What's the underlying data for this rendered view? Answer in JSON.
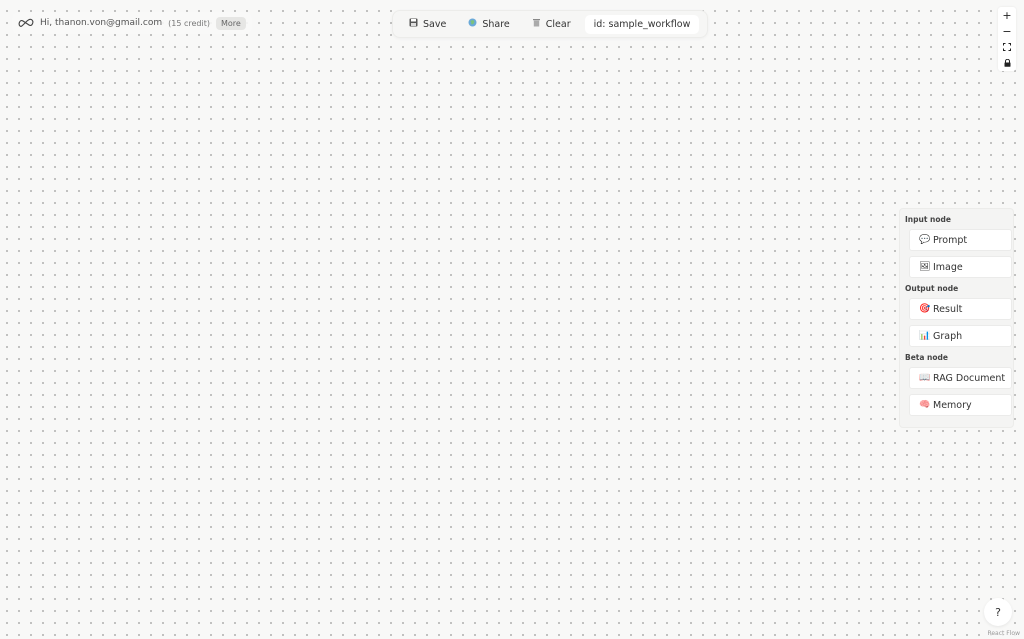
{
  "user_bar": {
    "greeting": "Hi, thanon.von@gmail.com",
    "credit": "(15 credit)",
    "more_label": "More",
    "logo_icon": "infinity-link-icon"
  },
  "toolbar": {
    "save_label": "Save",
    "save_icon": "floppy-disk-icon",
    "share_label": "Share",
    "share_icon": "globe-icon",
    "clear_label": "Clear",
    "clear_icon": "trash-icon",
    "id_label": "id: sample_workflow"
  },
  "controls": {
    "zoom_in": "+",
    "zoom_out": "−",
    "fit_icon": "fit-view-icon",
    "lock_icon": "lock-icon"
  },
  "palette": {
    "sections": [
      {
        "label": "Input node",
        "items": [
          {
            "emoji": "💬",
            "label": "Prompt"
          },
          {
            "emoji": "🖼",
            "label": "Image"
          }
        ]
      },
      {
        "label": "Output node",
        "items": [
          {
            "emoji": "🎯",
            "label": "Result"
          },
          {
            "emoji": "📊",
            "label": "Graph"
          }
        ]
      },
      {
        "label": "Beta node",
        "items": [
          {
            "emoji": "📖",
            "label": "RAG Document"
          },
          {
            "emoji": "🧠",
            "label": "Memory"
          }
        ]
      }
    ]
  },
  "help": {
    "label": "?"
  },
  "attribution": "React Flow",
  "colors": {
    "canvas_bg": "#f8f8f7",
    "dot": "#8f8f8f",
    "panel_bg": "#f4f4f3"
  }
}
